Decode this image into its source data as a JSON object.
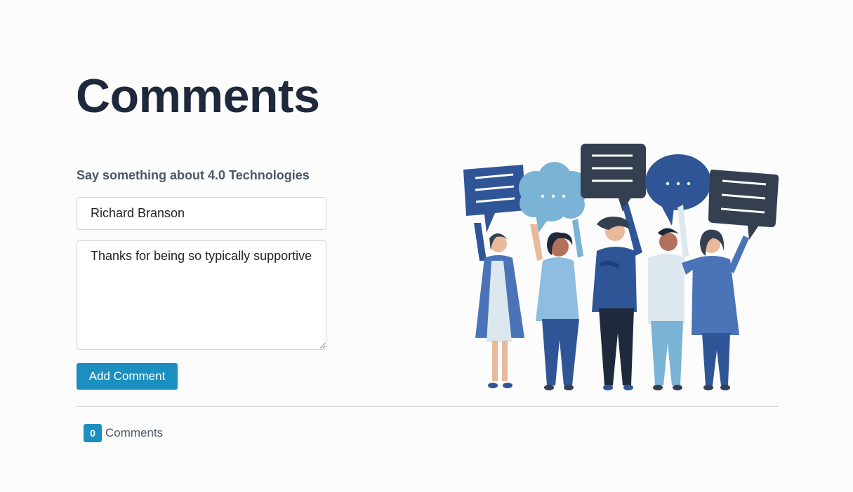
{
  "page": {
    "title": "Comments"
  },
  "form": {
    "label": "Say something about 4.0 Technologies",
    "name_value": "Richard Branson",
    "comment_value": "Thanks for being so typically supportive",
    "submit_label": "Add Comment"
  },
  "comments": {
    "count": "0",
    "label": "Comments"
  },
  "illustration": {
    "description_icon": "people-with-speech-bubbles-illustration"
  },
  "colors": {
    "accent": "#1b8fbf",
    "title": "#1e2a3b",
    "text_muted": "#4d5866",
    "bubble_dark": "#34404f",
    "bubble_blue": "#2f5597",
    "bubble_light": "#7ab3d6"
  }
}
